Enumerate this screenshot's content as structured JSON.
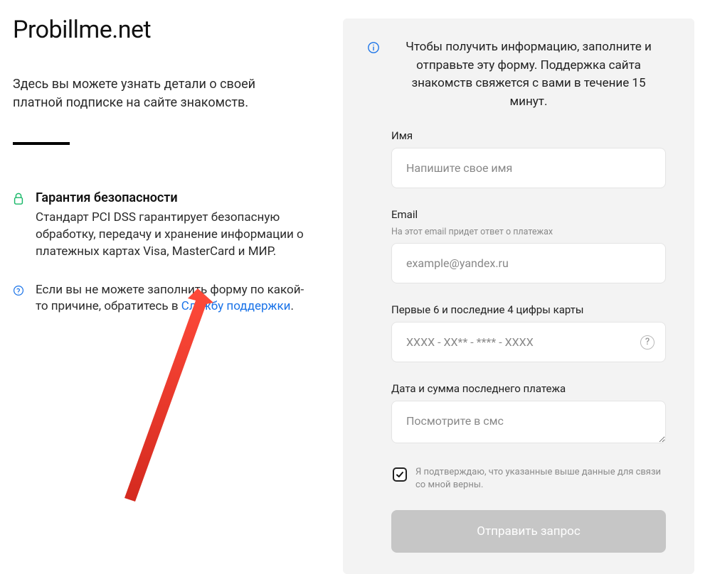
{
  "left": {
    "site_title": "Probillme.net",
    "intro": "Здесь вы можете узнать детали о своей платной подписке на сайте знакомств.",
    "security": {
      "heading": "Гарантия безопасности",
      "text": "Стандарт PCI DSS гарантирует безопасную обработку, передачу и хранение информации о платежных картах Visa, MasterCard и МИР."
    },
    "help": {
      "prefix": "Если вы не можете заполнить форму по какой-то причине, обратитесь в ",
      "link_text": "Службу поддержки",
      "suffix": "."
    }
  },
  "form": {
    "intro": "Чтобы получить информацию, заполните и отправьте эту форму. Поддержка сайта знакомств свяжется с вами в течение 15 минут.",
    "fields": {
      "name": {
        "label": "Имя",
        "placeholder": "Напишите свое имя"
      },
      "email": {
        "label": "Email",
        "help": "На этот email придет ответ о платежах",
        "placeholder": "example@yandex.ru"
      },
      "card": {
        "label": "Первые 6 и последние 4 цифры карты",
        "placeholder": "XXXX - XX** - **** - XXXX"
      },
      "payment": {
        "label": "Дата и сумма последнего платежа",
        "placeholder": "Посмотрите в смс"
      }
    },
    "consent": "Я подтверждаю, что указанные выше данные для связи со мной верны.",
    "submit": "Отправить запрос"
  }
}
